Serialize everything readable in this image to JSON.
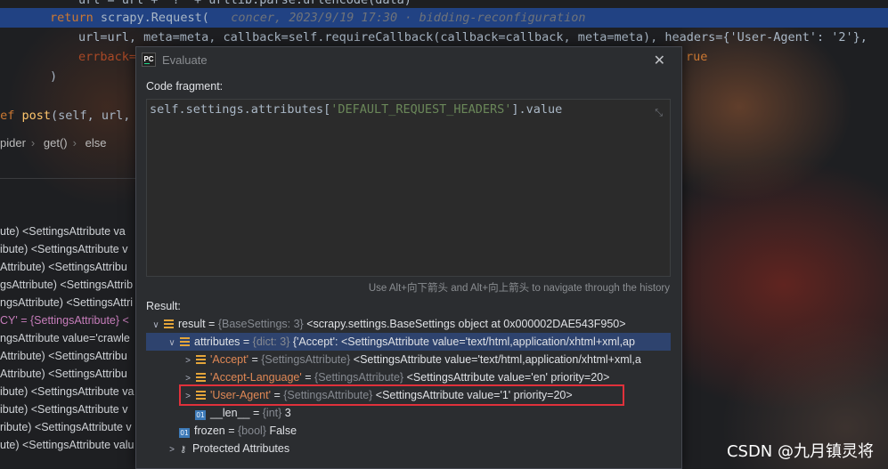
{
  "editor_code": {
    "line0": "url = url + '?' + urllib.parse.urlencode(data)",
    "line1_kw": "return",
    "line1_call": " scrapy.Request(",
    "line1_annot": "   concer, 2023/9/19 17:30 · bidding-reconfiguration",
    "line2_text": "url=url, meta=meta, callback=self.requireCallback(callback=callback, meta=meta), headers={'User-Agent': '2'},",
    "line3_text": "errback=",
    "line3_tail": "rue",
    "line4_text": ")",
    "line5_kw": "def",
    "line5_fn": " post",
    "line5_rest": "(self, url,"
  },
  "breadcrumb": {
    "item1": "pider",
    "item2": "get()",
    "item3": "else"
  },
  "side_vars": [
    "ute) <SettingsAttribute va",
    "ibute) <SettingsAttribute v",
    "Attribute) <SettingsAttribu",
    "gsAttribute) <SettingsAttrib",
    "ngsAttribute) <SettingsAttri",
    "CY' = {SettingsAttribute} <",
    "ngsAttribute value='crawle",
    "Attribute) <SettingsAttribu",
    "Attribute) <SettingsAttribu",
    "ibute) <SettingsAttribute va",
    "ibute) <SettingsAttribute v",
    "ribute) <SettingsAttribute v",
    "ute) <SettingsAttribute valu"
  ],
  "dialog": {
    "title": "Evaluate",
    "close_icon": "close-icon",
    "code_fragment_label": "Code fragment:",
    "code_fragment_value": "self.settings.attributes['DEFAULT_REQUEST_HEADERS'].value",
    "history_hint": "Use Alt+向下箭头 and Alt+向上箭头 to navigate through the history",
    "result_label": "Result:"
  },
  "result_tree": [
    {
      "arrow": "∨",
      "icon": "field",
      "name": "result",
      "type": "{BaseSettings: 3}",
      "value": "<scrapy.settings.BaseSettings object at 0x000002DAE543F950>"
    },
    {
      "arrow": "∨",
      "icon": "field",
      "name": "attributes",
      "type": "{dict: 3}",
      "value": "{'Accept': <SettingsAttribute value='text/html,application/xhtml+xml,ap"
    },
    {
      "arrow": ">",
      "icon": "field",
      "name": "'Accept'",
      "type": "{SettingsAttribute}",
      "value": "<SettingsAttribute value='text/html,application/xhtml+xml,a"
    },
    {
      "arrow": ">",
      "icon": "field",
      "name": "'Accept-Language'",
      "type": "{SettingsAttribute}",
      "value": "<SettingsAttribute value='en' priority=20>"
    },
    {
      "arrow": ">",
      "icon": "field",
      "name": "'User-Agent'",
      "type": "{SettingsAttribute}",
      "value": "<SettingsAttribute value='1' priority=20>"
    },
    {
      "arrow": "",
      "icon": "01",
      "name": "__len__",
      "type": "{int}",
      "value": "3"
    },
    {
      "arrow": "",
      "icon": "01",
      "name": "frozen",
      "type": "{bool}",
      "value": "False"
    },
    {
      "arrow": ">",
      "icon": "key",
      "name": "Protected Attributes",
      "type": "",
      "value": ""
    }
  ],
  "watermark": "CSDN @九月镇灵将"
}
